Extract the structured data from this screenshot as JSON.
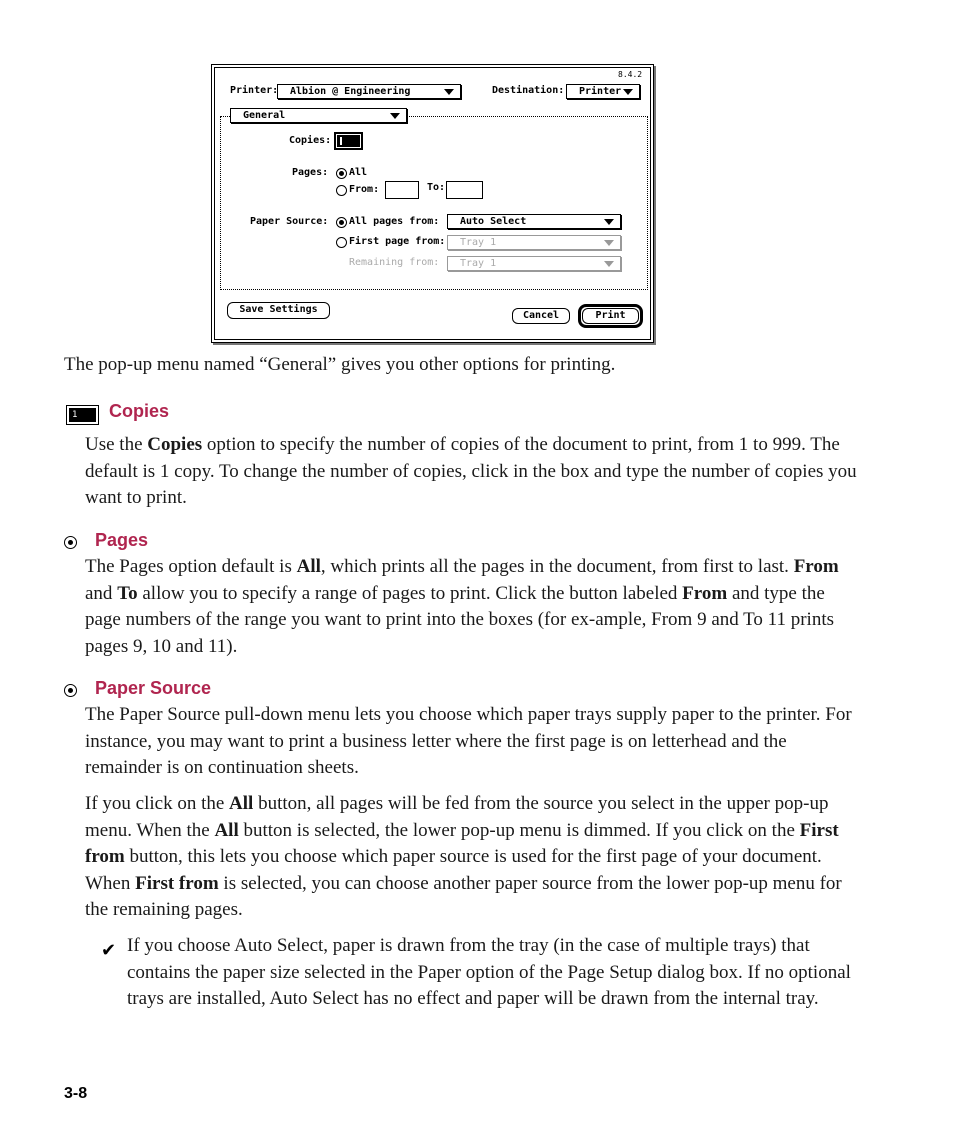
{
  "dialog": {
    "version": "8.4.2",
    "printer_label": "Printer:",
    "printer_value": "Albion @ Engineering",
    "destination_label": "Destination:",
    "destination_value": "Printer",
    "panel_value": "General",
    "copies_label": "Copies:",
    "copies_value": "1",
    "pages_label": "Pages:",
    "pages_all": "All",
    "pages_from": "From:",
    "pages_to": "To:",
    "pages_from_value": "",
    "pages_to_value": "",
    "pages_selected": "All",
    "paper_source_label": "Paper Source:",
    "all_pages_from": "All pages from:",
    "all_pages_value": "Auto Select",
    "first_page_from": "First page from:",
    "first_page_value": "Tray 1",
    "remaining_from": "Remaining from:",
    "remaining_value": "Tray 1",
    "paper_source_selected": "All pages from",
    "save_settings": "Save Settings",
    "cancel": "Cancel",
    "print": "Print"
  },
  "document": {
    "intro": "The pop-up menu named “General” gives you other options for printing.",
    "sections": [
      {
        "heading": "Copies",
        "icon": "copies-field-icon",
        "body": [
          "Use the ",
          {
            "b": "Copies"
          },
          " option to specify the number of copies of the document to print, from 1 to 999. The default is 1 copy. To change the number of copies, click in the box and type the number of copies you want to print."
        ]
      },
      {
        "heading": "Pages",
        "icon": "radio-button-icon",
        "body": [
          "The Pages option default is ",
          {
            "b": "All"
          },
          ", which prints all the pages in the document, from first to last. ",
          {
            "b": "From"
          },
          " and ",
          {
            "b": "To"
          },
          " allow you to specify a range of pages to print. Click the button labeled ",
          {
            "b": "From"
          },
          " and type the page numbers of the range you want to print into the boxes (for ex-ample, From 9 and To 11 prints pages 9, 10 and 11)."
        ]
      },
      {
        "heading": "Paper Source",
        "icon": "radio-button-icon",
        "body": [
          "The Paper Source pull-down menu lets you choose which paper trays supply paper to the printer. For instance, you may want to print a business letter where the first page is on letterhead and the remainder is on continuation sheets."
        ],
        "body2": [
          "If you click on the ",
          {
            "b": "All"
          },
          " button, all pages will be fed from the source you select in the upper pop-up menu. When the ",
          {
            "b": "All"
          },
          " button is selected, the lower pop-up menu is dimmed. If you click on the ",
          {
            "b": "First from"
          },
          " button, this lets you choose which paper source is used for the first page of your document. When ",
          {
            "b": "First from"
          },
          " is selected, you can choose another paper source from the lower pop-up menu for the remaining pages."
        ],
        "note": "If you choose Auto Select, paper is drawn from the tray (in the case of multiple trays) that contains the paper size selected in the Paper option of the Page Setup dialog box. If no optional trays are installed, Auto Select has no effect and paper will be drawn from the internal tray."
      }
    ],
    "check_glyph": "✔",
    "page_number": "3-8"
  },
  "colors": {
    "heading": "#b0254f"
  }
}
